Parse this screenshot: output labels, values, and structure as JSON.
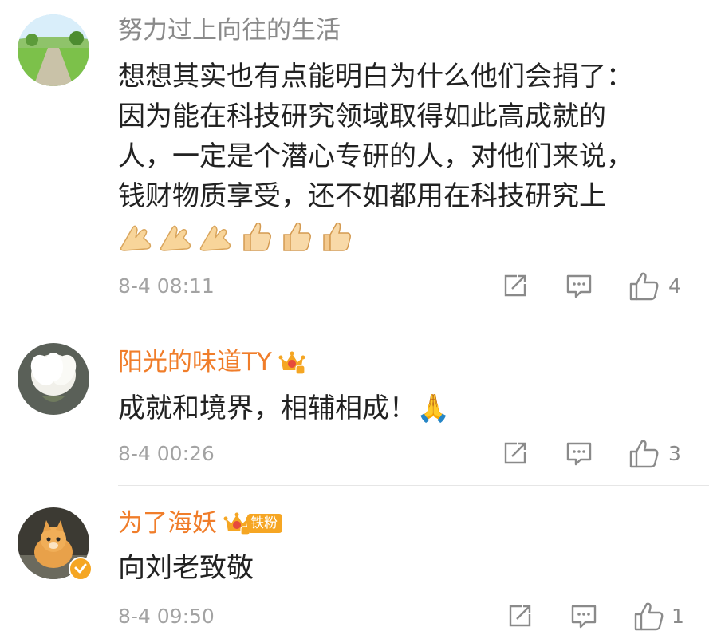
{
  "comments": [
    {
      "username": "努力过上向往的生活",
      "text_lines": [
        "想想其实也有点能明白为什么他们会捐了：",
        "因为能在科技研究领域取得如此高成就的",
        "人，一定是个潜心专研的人，对他们来说，",
        "钱财物质享受，还不如都用在科技研究上"
      ],
      "emojis": [
        "🙏",
        "🙏",
        "🙏",
        "👍",
        "👍",
        "👍"
      ],
      "timestamp": "8-4 08:11",
      "likes": "4"
    },
    {
      "username": "阳光的味道TY",
      "text": "成就和境界，相辅相成！🙏",
      "timestamp": "8-4 00:26",
      "likes": "3"
    },
    {
      "username": "为了海妖",
      "badge_label": "铁粉",
      "text": "向刘老致敬",
      "timestamp": "8-4 09:50",
      "likes": "1"
    }
  ],
  "colors": {
    "username_gray": "#8a8a8a",
    "username_orange": "#f07d2a",
    "text": "#222222",
    "meta": "#a3a3a3"
  }
}
